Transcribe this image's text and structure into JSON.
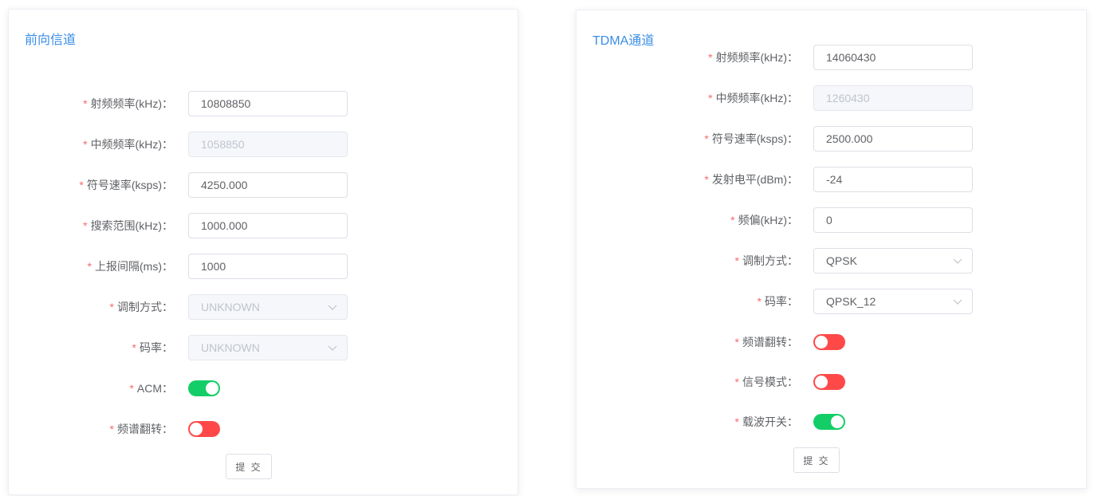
{
  "forward": {
    "title": "前向信道",
    "fields": [
      {
        "label": "射频频率(kHz)：",
        "required": true,
        "type": "input",
        "value": "10808850"
      },
      {
        "label": "中频频率(kHz)：",
        "required": true,
        "type": "input-disabled",
        "value": "1058850"
      },
      {
        "label": "符号速率(ksps)：",
        "required": true,
        "type": "input",
        "value": "4250.000"
      },
      {
        "label": "搜索范围(kHz)：",
        "required": true,
        "type": "input",
        "value": "1000.000"
      },
      {
        "label": "上报间隔(ms)：",
        "required": true,
        "type": "input",
        "value": "1000"
      },
      {
        "label": "调制方式：",
        "required": true,
        "type": "select-disabled",
        "value": "UNKNOWN"
      },
      {
        "label": "码率：",
        "required": true,
        "type": "select-disabled",
        "value": "UNKNOWN"
      },
      {
        "label": "ACM：",
        "required": true,
        "type": "switch",
        "on": true
      },
      {
        "label": "频谱翻转：",
        "required": true,
        "type": "switch",
        "on": false
      }
    ],
    "submit_label": "提 交"
  },
  "tdma": {
    "title": "TDMA通道",
    "fields": [
      {
        "label": "射频频率(kHz)：",
        "required": true,
        "type": "input",
        "value": "14060430"
      },
      {
        "label": "中频频率(kHz)：",
        "required": true,
        "type": "input-disabled",
        "value": "1260430"
      },
      {
        "label": "符号速率(ksps)：",
        "required": true,
        "type": "input",
        "value": "2500.000"
      },
      {
        "label": "发射电平(dBm)：",
        "required": true,
        "type": "input",
        "value": "-24"
      },
      {
        "label": "频偏(kHz)：",
        "required": true,
        "type": "input",
        "value": "0"
      },
      {
        "label": "调制方式：",
        "required": true,
        "type": "select",
        "value": "QPSK"
      },
      {
        "label": "码率：",
        "required": true,
        "type": "select",
        "value": "QPSK_12"
      },
      {
        "label": "频谱翻转：",
        "required": true,
        "type": "switch",
        "on": false
      },
      {
        "label": "信号模式：",
        "required": true,
        "type": "switch",
        "on": false
      },
      {
        "label": "载波开关：",
        "required": true,
        "type": "switch",
        "on": true
      }
    ],
    "submit_label": "提 交"
  },
  "required_mark": "*",
  "icons": {
    "select_arrow": "chevron-down-icon"
  },
  "colors": {
    "switch_on": "#13ce66",
    "switch_off": "#ff4949",
    "title": "#3a8ee6",
    "required": "#f56c6c"
  }
}
